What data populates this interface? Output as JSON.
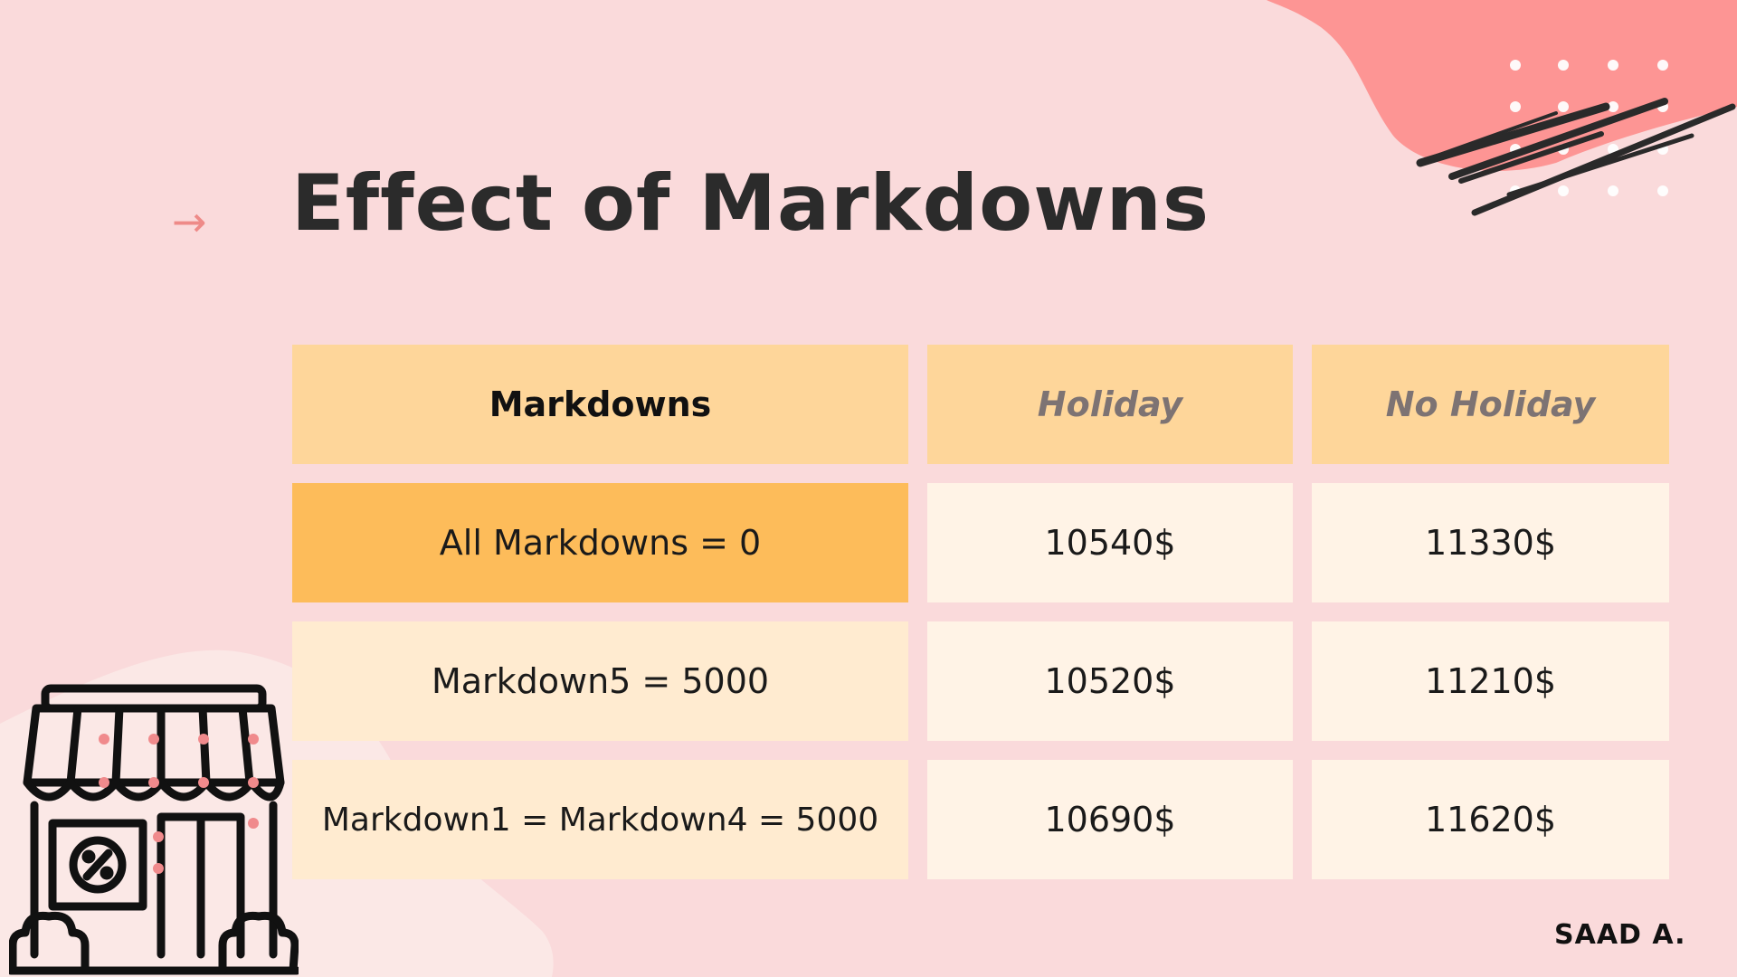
{
  "title": "Effect of Markdowns",
  "arrow": "→",
  "table": {
    "headers": [
      "Markdowns",
      "Holiday",
      "No Holiday"
    ],
    "rows": [
      {
        "label": "All Markdowns = 0",
        "holiday": "10540$",
        "no_holiday": "11330$"
      },
      {
        "label": "Markdown5 = 5000",
        "holiday": "10520$",
        "no_holiday": "11210$"
      },
      {
        "label": "Markdown1 = Markdown4 = 5000",
        "holiday": "10690$",
        "no_holiday": "11620$"
      }
    ]
  },
  "author": "SAAD A.",
  "colors": {
    "background": "#fadadb",
    "blob": "#fd9594",
    "header_cell": "#fed69a",
    "highlight_cell": "#fdbc5a",
    "label_cell": "#ffebd0",
    "value_cell": "#fff3e6",
    "arrow": "#ee8a88"
  },
  "icons": [
    "store-percent-icon",
    "arrow-right-icon",
    "dot-grid-decoration",
    "scribble-decoration"
  ]
}
